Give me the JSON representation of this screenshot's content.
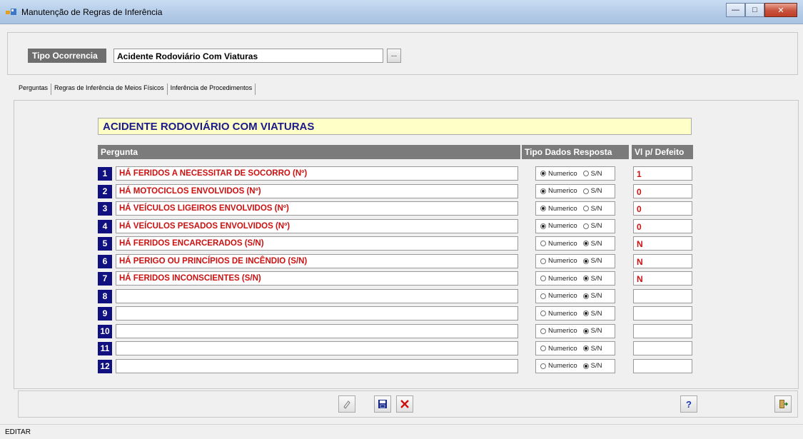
{
  "window": {
    "title": "Manutenção de Regras de Inferência",
    "minimize_icon": "minimize-icon",
    "maximize_icon": "maximize-icon",
    "close_icon": "close-icon"
  },
  "header": {
    "tipo_label": "Tipo Ocorrencia",
    "tipo_value": "Acidente Rodoviário Com Viaturas",
    "browse_label": "..."
  },
  "tabs": [
    {
      "label": "Perguntas"
    },
    {
      "label": "Regras de Inferência de Meios Físicos"
    },
    {
      "label": "Inferência de Procedimentos"
    }
  ],
  "main": {
    "banner": "ACIDENTE RODOVIÁRIO COM VIATURAS",
    "col_pergunta": "Pergunta",
    "col_tipo": "Tipo Dados Resposta",
    "col_defeito": "Vl p/ Defeito",
    "radio_numeric_label": "Numerico",
    "radio_sn_label": "S/N",
    "rows": [
      {
        "num": "1",
        "question": "HÁ FERIDOS A NECESSITAR DE SOCORRO (Nº)",
        "type": "Numerico",
        "default": "1"
      },
      {
        "num": "2",
        "question": "HÁ MOTOCICLOS ENVOLVIDOS (Nº)",
        "type": "Numerico",
        "default": "0"
      },
      {
        "num": "3",
        "question": "HÁ VEÍCULOS LIGEIROS ENVOLVIDOS (Nº)",
        "type": "Numerico",
        "default": "0"
      },
      {
        "num": "4",
        "question": "HÁ VEÍCULOS PESADOS ENVOLVIDOS (Nº)",
        "type": "Numerico",
        "default": "0"
      },
      {
        "num": "5",
        "question": "HÁ FERIDOS ENCARCERADOS (S/N)",
        "type": "S/N",
        "default": "N"
      },
      {
        "num": "6",
        "question": "HÁ PERIGO OU PRINCÍPIOS DE INCÊNDIO (S/N)",
        "type": "S/N",
        "default": "N"
      },
      {
        "num": "7",
        "question": "HÁ FERIDOS INCONSCIENTES (S/N)",
        "type": "S/N",
        "default": "N"
      },
      {
        "num": "8",
        "question": "",
        "type": "S/N",
        "default": ""
      },
      {
        "num": "9",
        "question": "",
        "type": "S/N",
        "default": ""
      },
      {
        "num": "10",
        "question": "",
        "type": "S/N",
        "default": ""
      },
      {
        "num": "11",
        "question": "",
        "type": "S/N",
        "default": ""
      },
      {
        "num": "12",
        "question": "",
        "type": "S/N",
        "default": ""
      }
    ]
  },
  "toolbar": {
    "edit_icon": "pencil-icon",
    "save_icon": "save-icon",
    "cancel_icon": "cancel-x-icon",
    "help_icon": "help-icon",
    "exit_icon": "exit-door-icon"
  },
  "status": {
    "mode": "EDITAR"
  }
}
